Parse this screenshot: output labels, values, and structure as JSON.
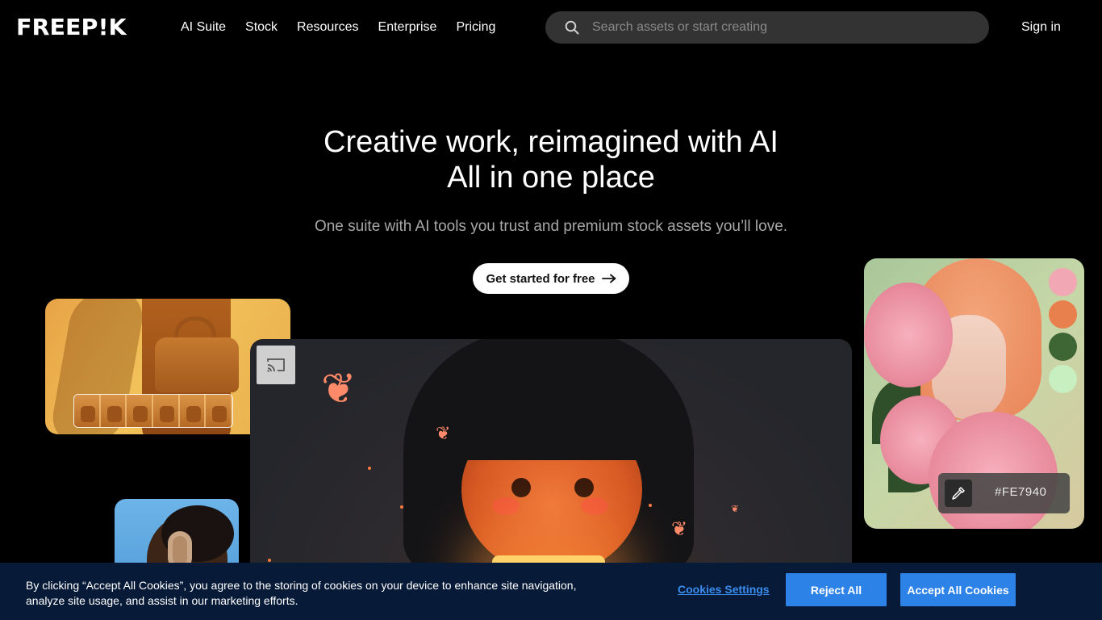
{
  "nav": {
    "logo": "FREEP!K",
    "links": [
      "AI Suite",
      "Stock",
      "Resources",
      "Enterprise",
      "Pricing"
    ],
    "search_placeholder": "Search assets or start creating",
    "signin": "Sign in"
  },
  "hero": {
    "title_line1": "Creative work, reimagined with AI",
    "title_line2": "All in one place",
    "subtitle": "One suite with AI tools you trust and premium stock assets you’ll love.",
    "cta_label": "Get started for free"
  },
  "cards": {
    "color_picker": {
      "hex": "#FE7940",
      "swatches": [
        "#f1a7b4",
        "#e8804e",
        "#3e6534",
        "#c8efc0"
      ]
    }
  },
  "cookie": {
    "text": "By clicking “Accept All Cookies”, you agree to the storing of cookies on your device to enhance site navigation, analyze site usage, and assist in our marketing efforts.",
    "settings_label": "Cookies Settings",
    "reject_label": "Reject All",
    "accept_label": "Accept All Cookies"
  },
  "colors": {
    "background": "#000000",
    "search_bg": "#333333",
    "cookie_bg": "#071a38",
    "button_blue": "#2d82e8"
  }
}
